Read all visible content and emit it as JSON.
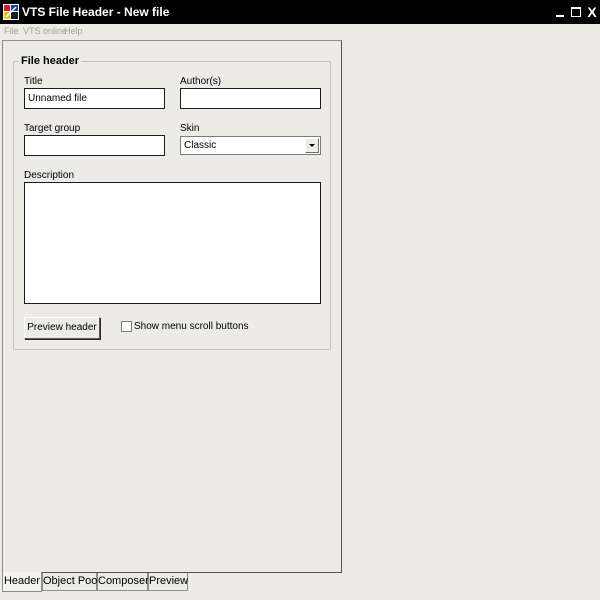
{
  "window": {
    "title": "VTS File Header - New file",
    "minimize_glyph": "",
    "maximize_glyph": "",
    "close_glyph": "X"
  },
  "menu": {
    "items": [
      {
        "label": "File"
      },
      {
        "label": "VTS online"
      },
      {
        "label": "Help"
      }
    ]
  },
  "file_header": {
    "group_title": "File header",
    "title_label": "Title",
    "title_value": "Unnamed file",
    "authors_label": "Author(s)",
    "authors_value": "",
    "target_group_label": "Target group",
    "target_group_value": "",
    "skin_label": "Skin",
    "skin_value": "Classic",
    "description_label": "Description",
    "description_value": "",
    "preview_button_label": "Preview header",
    "scroll_buttons_label": "Show menu scroll buttons",
    "scroll_buttons_checked": false
  },
  "tabs": [
    {
      "label": "Header",
      "active": true
    },
    {
      "label": "Object Pool",
      "active": false
    },
    {
      "label": "Composer",
      "active": false
    },
    {
      "label": "Preview",
      "active": false
    }
  ],
  "colors": {
    "titlebar": "#000000",
    "background": "#ecebe6",
    "disabled_menu_text": "#a5a29a"
  },
  "icons": {
    "app": "vts-app-icon",
    "skin_dropdown": "chevron-down-icon"
  }
}
